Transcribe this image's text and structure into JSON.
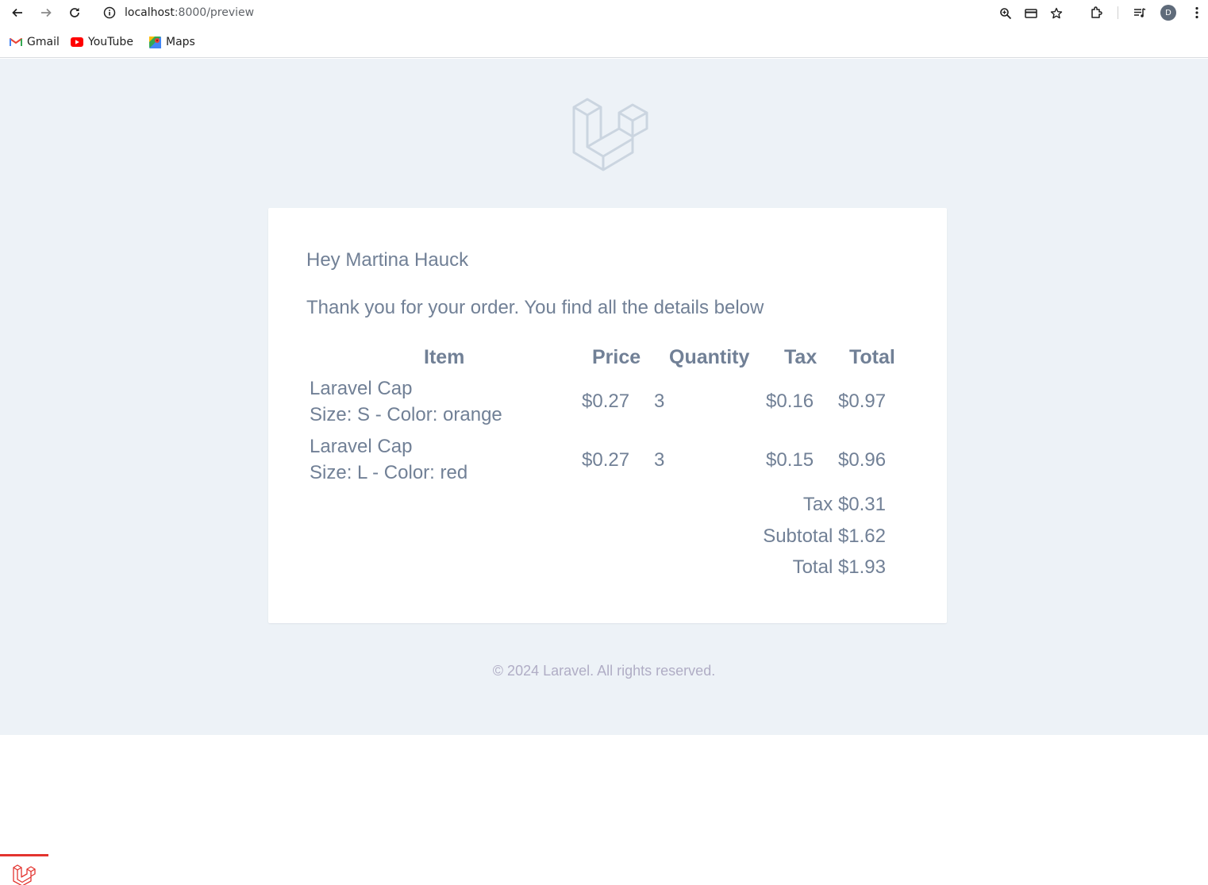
{
  "browser": {
    "url_host": "localhost",
    "url_path": ":8000/preview",
    "avatar_initial": "D",
    "bookmarks": [
      {
        "label": "Gmail",
        "icon": "gmail-icon"
      },
      {
        "label": "YouTube",
        "icon": "youtube-icon"
      },
      {
        "label": "Maps",
        "icon": "maps-icon"
      }
    ],
    "icons": [
      "back-icon",
      "forward-icon",
      "reload-icon",
      "site-info-icon",
      "zoom-icon",
      "card-icon",
      "star-icon",
      "extensions-icon",
      "media-icon",
      "menu-icon"
    ]
  },
  "email": {
    "greeting": "Hey Martina Hauck",
    "intro": "Thank you for your order. You find all the details below",
    "headers": {
      "item": "Item",
      "price": "Price",
      "quantity": "Quantity",
      "tax": "Tax",
      "total": "Total"
    },
    "rows": [
      {
        "name": "Laravel Cap",
        "variant": "Size: S - Color: orange",
        "price": "$0.27",
        "quantity": "3",
        "tax": "$0.16",
        "total": "$0.97"
      },
      {
        "name": "Laravel Cap",
        "variant": "Size: L - Color: red",
        "price": "$0.27",
        "quantity": "3",
        "tax": "$0.15",
        "total": "$0.96"
      }
    ],
    "summary": {
      "tax": "Tax $0.31",
      "subtotal": "Subtotal $1.62",
      "total": "Total $1.93"
    },
    "footer": "© 2024 Laravel. All rights reserved."
  },
  "colors": {
    "text": "#718096",
    "background": "#edf2f7",
    "accent": "#e3342f"
  }
}
